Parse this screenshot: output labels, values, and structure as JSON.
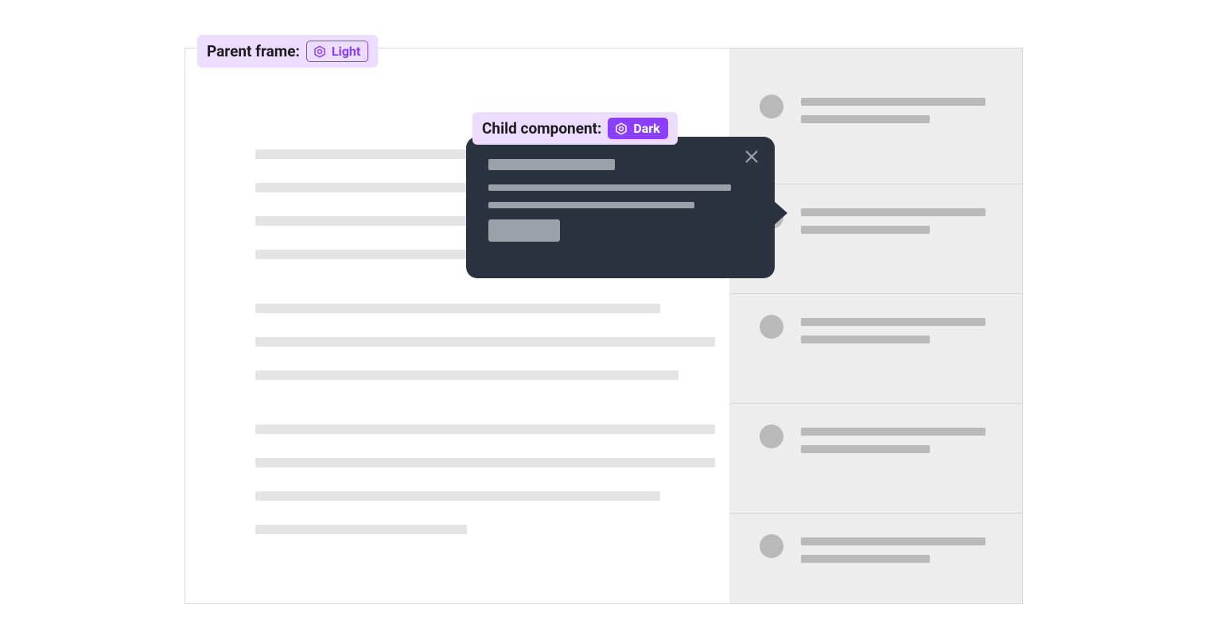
{
  "parent_label": {
    "prefix": "Parent frame:",
    "mode": "Light"
  },
  "child_label": {
    "prefix": "Child component:",
    "mode": "Dark"
  },
  "icons": {
    "variable": "variable-icon",
    "close": "close-icon"
  },
  "colors": {
    "accent": "#8a3ffc",
    "pill_bg": "#ecdcff",
    "popover_bg": "#2b3240",
    "sidebar_bg": "#ededed",
    "placeholder": "#e4e4e4",
    "placeholder_dark": "#b9b9b9"
  }
}
